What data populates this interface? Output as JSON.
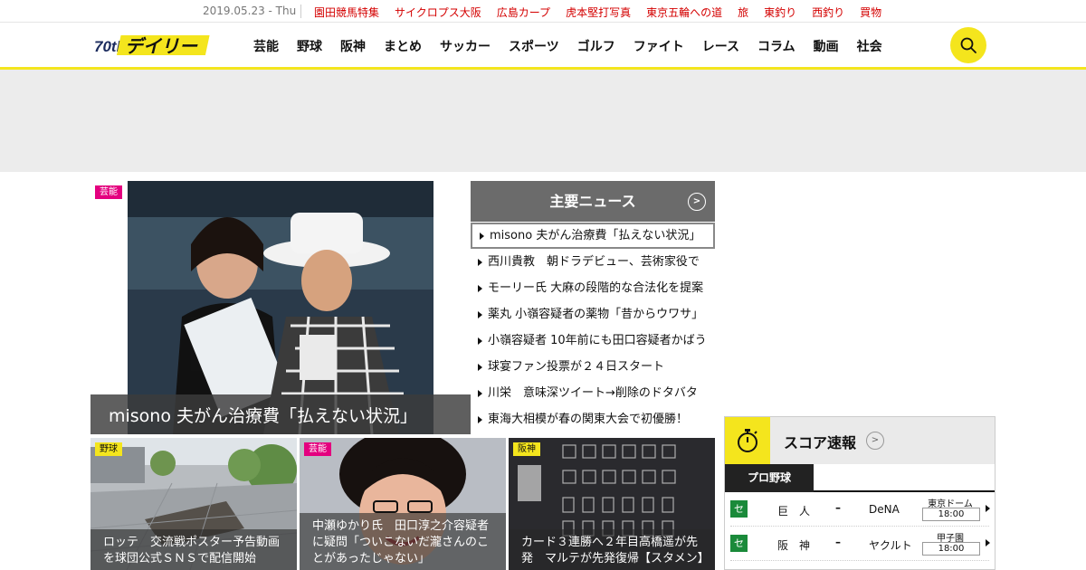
{
  "utility": {
    "date": "2019.05.23 - Thu",
    "links": [
      "園田競馬特集",
      "サイクロプス大阪",
      "広島カープ",
      "虎本堅打写真",
      "東京五輪への道",
      "旅",
      "東釣り",
      "西釣り",
      "買物"
    ]
  },
  "header": {
    "logo_text": "デイリー",
    "logo_badge": "70th",
    "nav": [
      "芸能",
      "野球",
      "阪神",
      "まとめ",
      "サッカー",
      "スポーツ",
      "ゴルフ",
      "ファイト",
      "レース",
      "コラム",
      "動画",
      "社会"
    ]
  },
  "hero": {
    "badge": "芸能",
    "caption": "misono 夫がん治療費「払えない状況」"
  },
  "main_news": {
    "heading": "主要ニュース",
    "items": [
      "misono 夫がん治療費「払えない状況」",
      "西川貴教　朝ドラデビュー、芸術家役で",
      "モーリー氏 大麻の段階的な合法化を提案",
      "薬丸 小嶺容疑者の薬物「昔からウワサ」",
      "小嶺容疑者 10年前にも田口容疑者かばう",
      "球宴ファン投票が２４日スタート",
      "川栄　意味深ツイート→削除のドタバタ",
      "東海大相模が春の関東大会で初優勝！"
    ]
  },
  "cards": [
    {
      "badge": "野球",
      "caption": "ロッテ　交流戦ポスター予告動画を球団公式ＳＮＳで配信開始"
    },
    {
      "badge": "芸能",
      "caption": "中瀬ゆかり氏　田口淳之介容疑者に疑問「ついこないだ瀧さんのことがあったじゃない」"
    },
    {
      "badge": "阪神",
      "caption": "カード３連勝へ２年目高橋遥が先発　マルテが先発復帰【スタメン】"
    }
  ],
  "score": {
    "title": "スコア速報",
    "tab": "プロ野球",
    "games": [
      {
        "league": "セ",
        "home": "巨　人",
        "dash": "–",
        "away": "DeNA",
        "venue": "東京ドーム",
        "time": "18:00"
      },
      {
        "league": "セ",
        "home": "阪　神",
        "dash": "–",
        "away": "ヤクルト",
        "venue": "甲子園",
        "time": "18:00"
      }
    ]
  },
  "colors": {
    "accent_yellow": "#f4e51d",
    "link_red": "#d40000",
    "geino_pink": "#e4007f",
    "league_green": "#1a8a3a"
  }
}
